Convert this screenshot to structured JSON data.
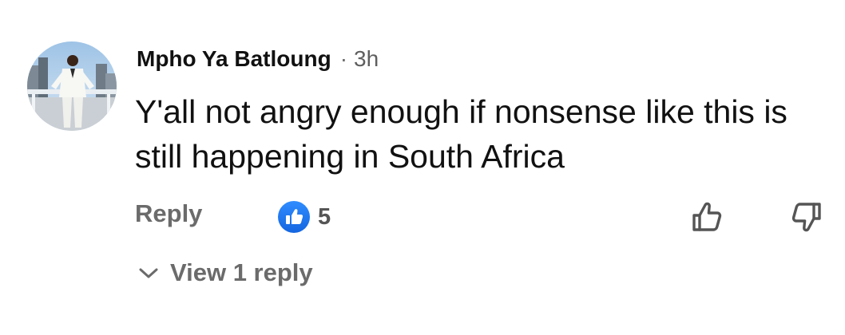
{
  "comment": {
    "author": "Mpho Ya Batloung",
    "separator": "·",
    "time": "3h",
    "text": "Y'all not angry enough if nonsense like this is still happening in South Africa"
  },
  "actions": {
    "reply_label": "Reply",
    "reaction_icon": "like-icon",
    "reaction_count": "5",
    "like_icon": "thumb-up-outline-icon",
    "dislike_icon": "thumb-down-outline-icon"
  },
  "replies": {
    "view_label": "View 1 reply",
    "icon": "chevron-down-icon"
  },
  "colors": {
    "like_blue": "#1877f2",
    "muted_gray": "#6b6b6b",
    "text": "#111111"
  }
}
